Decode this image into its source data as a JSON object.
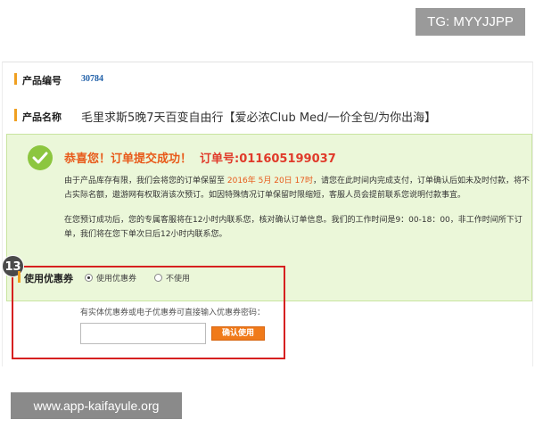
{
  "tg_badge": "TG: MYYJJPP",
  "product": {
    "id_label": "产品编号",
    "id_value": "30784",
    "name_label": "产品名称",
    "name_value": "毛里求斯5晚7天百变自由行【爱必浓Club Med/一价全包/为你出海】"
  },
  "success": {
    "title": "恭喜您！订单提交成功！",
    "order_no": "订单号:011605199037",
    "para1_before": "由于产品库存有限，我们会将您的订单保留至 ",
    "para1_highlight": "2016年 5月 20日 17时",
    "para1_after": "，请您在此时间内完成支付，订单确认后如未及时付款，将不占实际名额，遨游网有权取消该次预订。如因特殊情况订单保留时限缩短，客服人员会提前联系您说明付款事宜。",
    "para2": "在您预订成功后，您的专属客服将在12小时内联系您，核对确认订单信息。我们的工作时间是9：00-18：00，非工作时间所下订单，我们将在您下单次日后12小时内联系您。"
  },
  "coupon": {
    "step_number": "13",
    "label": "使用优惠券",
    "option_use": "使用优惠券",
    "option_nouse": "不使用",
    "selected": "use",
    "hint": "有实体优惠券或电子优惠券可直接输入优惠券密码：",
    "input_value": "",
    "input_placeholder": "",
    "confirm_button": "确认使用"
  },
  "watermark": "www.app-kaifayule.org",
  "colors": {
    "accent_orange": "#f0a020",
    "success_bg": "#ebf7d9",
    "check_green": "#8cc63f",
    "title_orange": "#e85a1a",
    "order_red": "#e03a2a",
    "highlight_frame": "#d62020",
    "button_orange": "#f07a1a",
    "id_blue": "#1f5fa8"
  },
  "icons": {
    "success": "check-circle-icon"
  }
}
